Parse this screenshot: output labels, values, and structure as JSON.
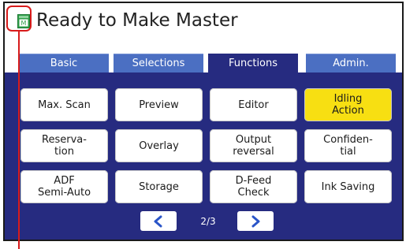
{
  "header": {
    "title": "Ready to Make Master",
    "status_icon": "master-document-icon"
  },
  "tabs": [
    {
      "label": "Basic",
      "active": false
    },
    {
      "label": "Selections",
      "active": false
    },
    {
      "label": "Functions",
      "active": true
    },
    {
      "label": "Admin.",
      "active": false
    }
  ],
  "functions": [
    {
      "label": "Max. Scan",
      "highlighted": false
    },
    {
      "label": "Preview",
      "highlighted": false
    },
    {
      "label": "Editor",
      "highlighted": false
    },
    {
      "label": "Idling\nAction",
      "highlighted": true
    },
    {
      "label": "Reserva-\ntion",
      "highlighted": false
    },
    {
      "label": "Overlay",
      "highlighted": false
    },
    {
      "label": "Output\nreversal",
      "highlighted": false
    },
    {
      "label": "Confiden-\ntial",
      "highlighted": false
    },
    {
      "label": "ADF\nSemi-Auto",
      "highlighted": false
    },
    {
      "label": "Storage",
      "highlighted": false
    },
    {
      "label": "D-Feed\nCheck",
      "highlighted": false
    },
    {
      "label": "Ink Saving",
      "highlighted": false
    }
  ],
  "pager": {
    "indicator": "2/3",
    "prev_icon": "chevron-left-icon",
    "next_icon": "chevron-right-icon"
  },
  "colors": {
    "panel": "#262b80",
    "tab": "#4b6fc2",
    "highlight": "#f7df12",
    "callout": "#d81b1b",
    "icon_green": "#2e9e48"
  }
}
